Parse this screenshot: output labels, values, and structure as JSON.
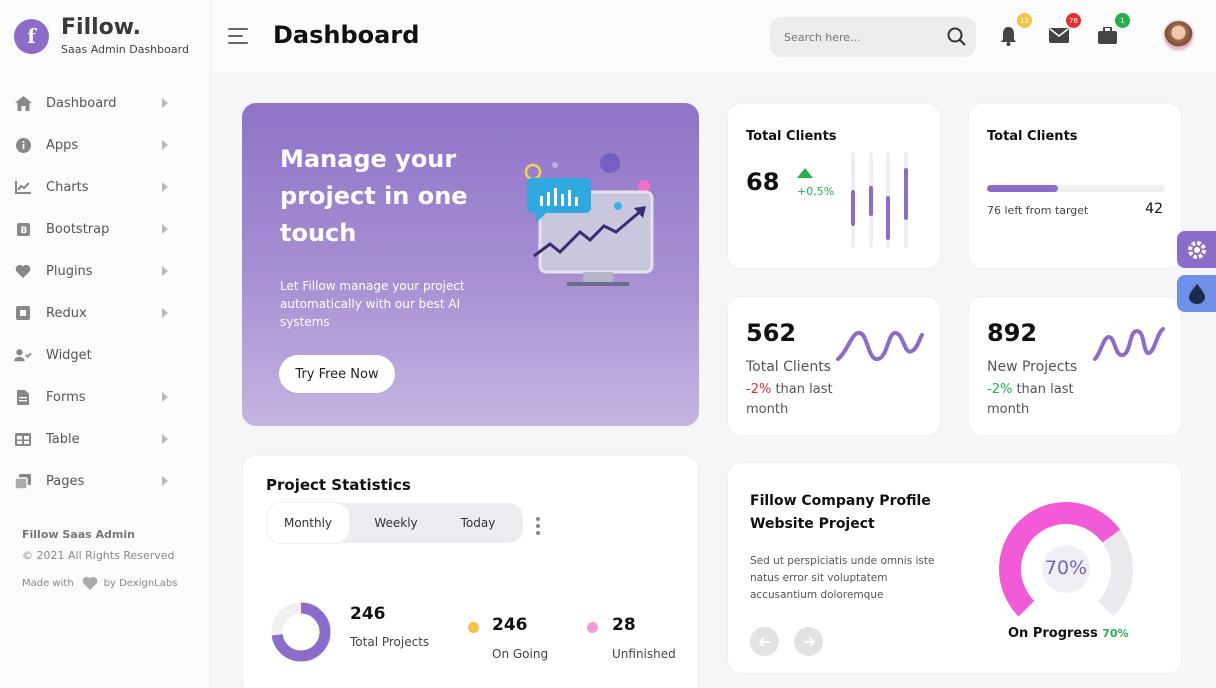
{
  "brand": {
    "letter": "f",
    "name": "Fillow.",
    "subtitle": "Saas Admin Dashboard"
  },
  "sidebar": {
    "items": [
      {
        "label": "Dashboard",
        "icon": "home-icon"
      },
      {
        "label": "Apps",
        "icon": "info-icon"
      },
      {
        "label": "Charts",
        "icon": "chart-line-icon"
      },
      {
        "label": "Bootstrap",
        "icon": "bootstrap-icon"
      },
      {
        "label": "Plugins",
        "icon": "heart-icon"
      },
      {
        "label": "Redux",
        "icon": "square-icon"
      },
      {
        "label": "Widget",
        "icon": "user-check-icon"
      },
      {
        "label": "Forms",
        "icon": "file-icon"
      },
      {
        "label": "Table",
        "icon": "table-icon"
      },
      {
        "label": "Pages",
        "icon": "copy-icon"
      }
    ],
    "footer": {
      "title": "Fillow Saas Admin",
      "copyright": "© 2021 All Rights Reserved",
      "made_with": "Made with",
      "by": "by DexignLabs"
    }
  },
  "header": {
    "title": "Dashboard",
    "search_placeholder": "Search here...",
    "badges": {
      "notifications": "12",
      "messages": "76",
      "tasks": "1"
    }
  },
  "hero": {
    "title": "Manage your project in one touch",
    "body": "Let Fillow manage your project automatically with our best AI systems",
    "button": "Try Free Now"
  },
  "cards": {
    "clients_a": {
      "title": "Total Clients",
      "value": "68",
      "change": "+0,5%"
    },
    "clients_b": {
      "title": "Total Clients",
      "progress_pct": 40,
      "note": "76 left from target",
      "value": "42"
    },
    "clients_c": {
      "value": "562",
      "label": "Total Clients",
      "delta": "-2%",
      "suffix": " than last month"
    },
    "projects": {
      "value": "892",
      "label": "New Projects",
      "delta": "-2%",
      "suffix": " than last month"
    }
  },
  "project_stats": {
    "title": "Project Statistics",
    "tabs": [
      "Monthly",
      "Weekly",
      "Today"
    ],
    "total": {
      "value": "246",
      "label": "Total Projects"
    },
    "ongoing": {
      "value": "246",
      "label": "On Going"
    },
    "unfinished": {
      "value": "28",
      "label": "Unfinished"
    }
  },
  "company": {
    "title": "Fillow Company Profile Website Project",
    "body": "Sed ut perspiciatis unde omnis iste natus error sit voluptatem accusantium doloremque",
    "gauge_value": "70%",
    "status": "On Progress",
    "status_value": "70%",
    "progress_fraction": 0.7
  },
  "colors": {
    "accent": "#8b6cc9",
    "green": "#23b14d",
    "red": "#e0312f",
    "pink": "#f35ad8"
  }
}
